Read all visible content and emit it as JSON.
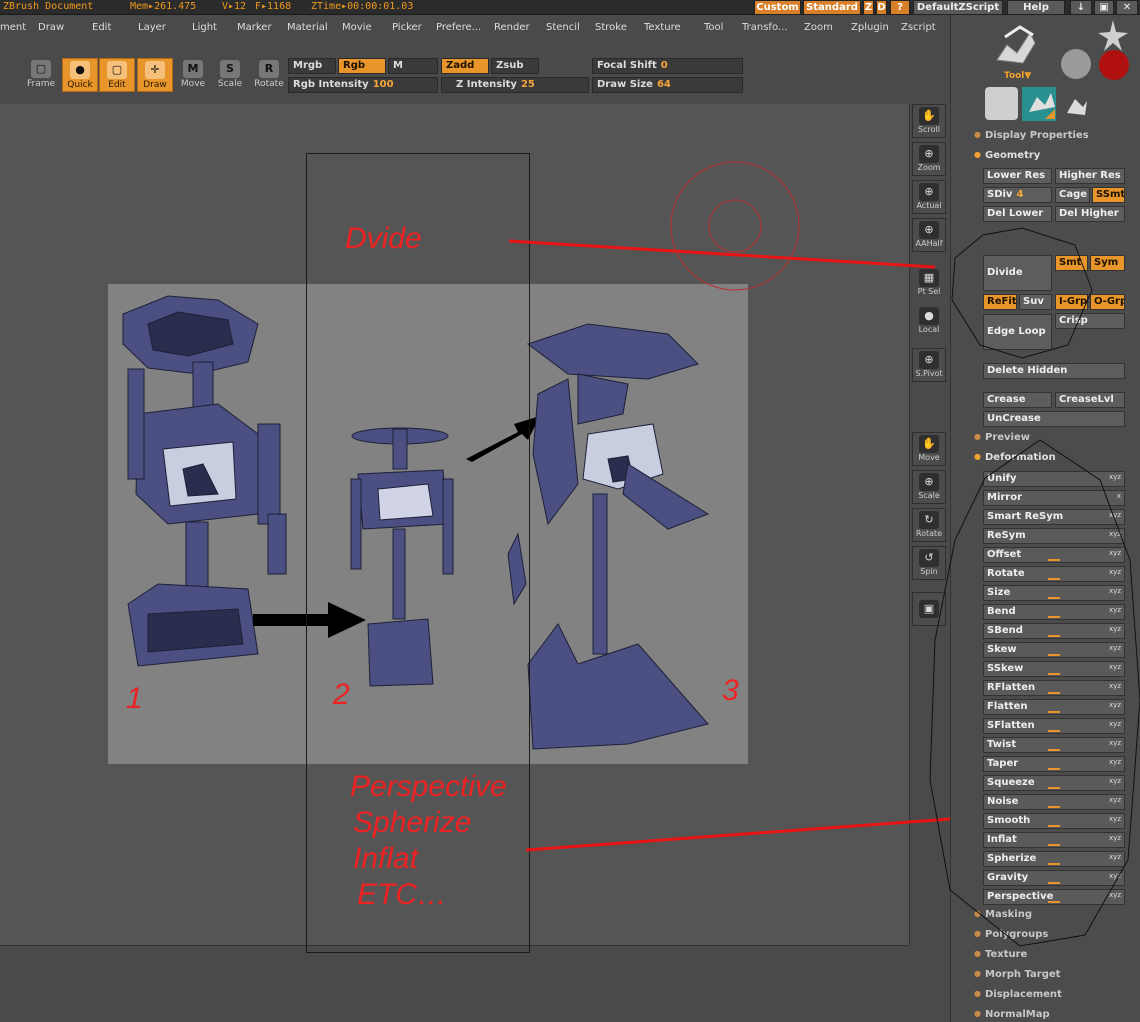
{
  "titlebar": {
    "doc_title": "ZBrush Document",
    "mem": "Mem▸261.475",
    "verts": "V▸12",
    "faces": "F▸1168",
    "ztime": "ZTime▸00:00:01.03",
    "custom_btn": "Custom",
    "standard_btn": "Standard",
    "z_btn": "Z",
    "d_btn": "D",
    "q_btn": "?",
    "zscript_btn": "DefaultZScript",
    "help_btn": "Help"
  },
  "menu": [
    "ment",
    "Draw",
    "Edit",
    "Layer",
    "Light",
    "Marker",
    "Material",
    "Movie",
    "Picker",
    "Prefere...",
    "Render",
    "Stencil",
    "Stroke",
    "Texture",
    "Tool",
    "Transfo...",
    "Zoom",
    "Zplugin",
    "Zscript"
  ],
  "toolbar": {
    "frame": "Frame",
    "quick": "Quick",
    "edit": "Edit",
    "draw": "Draw",
    "move": "Move",
    "scale": "Scale",
    "rotate": "Rotate",
    "move_glyph": "M",
    "scale_glyph": "S",
    "rotate_glyph": "R",
    "mrgb": "Mrgb",
    "rgb": "Rgb",
    "m": "M",
    "zadd": "Zadd",
    "zsub": "Zsub",
    "rgb_intensity_label": "Rgb Intensity",
    "rgb_intensity_value": "100",
    "z_intensity_label": "Z Intensity",
    "z_intensity_value": "25",
    "focal_shift_label": "Focal Shift",
    "focal_shift_value": "0",
    "draw_size_label": "Draw Size",
    "draw_size_value": "64"
  },
  "shelf": {
    "scroll": "Scroll",
    "zoom": "Zoom",
    "actual": "Actual",
    "aahalf": "AAHalf",
    "ptsel": "Pt Sel",
    "local": "Local",
    "spivot": "S.Pivot",
    "move": "Move",
    "scale": "Scale",
    "rotate": "Rotate",
    "spin": "Spin"
  },
  "panel": {
    "tool_label": "Tool",
    "display_properties": "Display Properties",
    "geometry": "Geometry",
    "lower_res": "Lower Res",
    "higher_res": "Higher Res",
    "sdiv_label": "SDiv",
    "sdiv_value": "4",
    "cage": "Cage",
    "ssmt": "SSmt",
    "del_lower": "Del Lower",
    "del_higher": "Del Higher",
    "divide": "Divide",
    "smt": "Smt",
    "sym": "Sym",
    "refit": "ReFit",
    "suv": "Suv",
    "igrp": "I-Grp",
    "ogrp": "O-Grp",
    "edge_loop": "Edge Loop",
    "crisp": "Crisp",
    "delete_hidden": "Delete Hidden",
    "crease": "Crease",
    "creaselvl": "CreaseLvl",
    "uncrease": "UnCrease",
    "preview": "Preview",
    "deformation": "Deformation",
    "masking": "Masking",
    "polygroups": "Polygroups",
    "texture": "Texture",
    "morph_target": "Morph Target",
    "displacement": "Displacement",
    "normalmap": "NormalMap"
  },
  "deformation_items": [
    {
      "label": "Unify",
      "axes": "xyz",
      "slider": false
    },
    {
      "label": "Mirror",
      "axes": "x",
      "slider": false
    },
    {
      "label": "Smart ReSym",
      "axes": "xyz",
      "slider": false
    },
    {
      "label": "ReSym",
      "axes": "xyz",
      "slider": false
    },
    {
      "label": "Offset",
      "axes": "xyz",
      "slider": true
    },
    {
      "label": "Rotate",
      "axes": "xyz",
      "slider": true
    },
    {
      "label": "Size",
      "axes": "xyz",
      "slider": true
    },
    {
      "label": "Bend",
      "axes": "xyz",
      "slider": true
    },
    {
      "label": "SBend",
      "axes": "xyz",
      "slider": true
    },
    {
      "label": "Skew",
      "axes": "xyz",
      "slider": true
    },
    {
      "label": "SSkew",
      "axes": "xyz",
      "slider": true
    },
    {
      "label": "RFlatten",
      "axes": "xyz",
      "slider": true
    },
    {
      "label": "Flatten",
      "axes": "xyz",
      "slider": true
    },
    {
      "label": "SFlatten",
      "axes": "xyz",
      "slider": true
    },
    {
      "label": "Twist",
      "axes": "xyz",
      "slider": true
    },
    {
      "label": "Taper",
      "axes": "xyz",
      "slider": true
    },
    {
      "label": "Squeeze",
      "axes": "xyz",
      "slider": true
    },
    {
      "label": "Noise",
      "axes": "xyz",
      "slider": true
    },
    {
      "label": "Smooth",
      "axes": "xyz",
      "slider": true
    },
    {
      "label": "Inflat",
      "axes": "xyz",
      "slider": true
    },
    {
      "label": "Spherize",
      "axes": "xyz",
      "slider": true
    },
    {
      "label": "Gravity",
      "axes": "xyz",
      "slider": true
    },
    {
      "label": "Perspective",
      "axes": "xyz",
      "slider": true
    }
  ],
  "annotations": {
    "dvide": "Dvide",
    "list_line1": "Perspective",
    "list_line2": "Spherize",
    "list_line3": "Inflat",
    "list_line4": "ETC…",
    "step1": "1",
    "step2": "2",
    "step3": "3"
  },
  "colors": {
    "accent": "#e8952c",
    "annotation": "#ee2222",
    "robot": "#4b4f82"
  }
}
